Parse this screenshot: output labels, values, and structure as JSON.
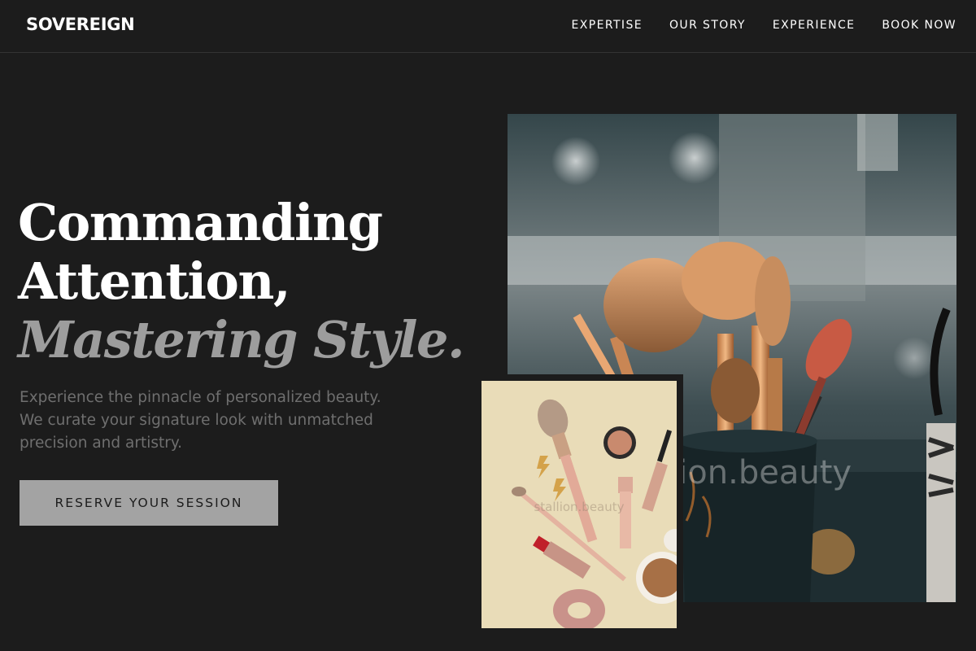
{
  "header": {
    "brand": "SOVEREIGN",
    "nav": [
      "EXPERTISE",
      "OUR STORY",
      "EXPERIENCE",
      "BOOK NOW"
    ]
  },
  "hero": {
    "headline_line1": "Commanding",
    "headline_line2": "Attention,",
    "headline_accent": "Mastering Style.",
    "lead_line1": "Experience the pinnacle of personalized beauty.",
    "lead_line2": "We curate your signature look with unmatched",
    "lead_line3": "precision and artistry.",
    "cta_label": "RESERVE YOUR SESSION"
  },
  "images": {
    "main_watermark": "stallion.beauty",
    "small_watermark": "stallion.beauty"
  },
  "colors": {
    "background": "#1c1c1c",
    "text_primary": "#ffffff",
    "accent_grey": "#9d9d9d",
    "cta_background": "#a3a3a3"
  }
}
